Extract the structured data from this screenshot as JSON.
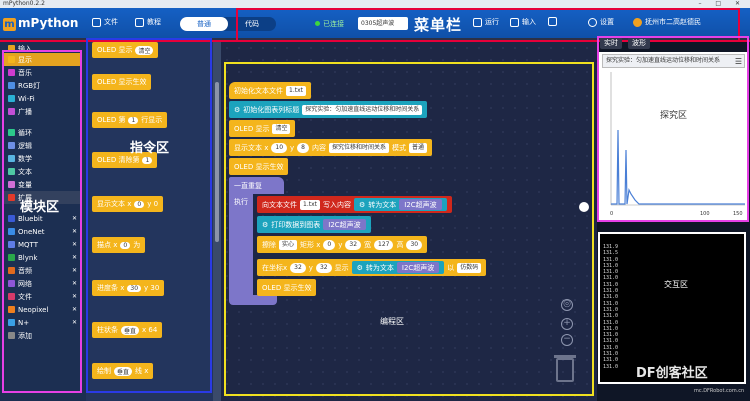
{
  "window": {
    "title": "mPython0.2.2"
  },
  "menubar": {
    "logo": "mPython",
    "file": "文件",
    "tutorial": "教程",
    "mode_normal": "普通",
    "mode_code": "代码",
    "connected": "已连接",
    "device": "0305超声波",
    "label": "菜单栏",
    "run": "运行",
    "import": "输入",
    "export": "",
    "settings": "设置",
    "user": "抚州市二高赵德民"
  },
  "categories": {
    "items": [
      {
        "label": "输入",
        "color": "#e4a320"
      },
      {
        "label": "显示",
        "color": "#f4b51c"
      },
      {
        "label": "音乐",
        "color": "#ce3ccf"
      },
      {
        "label": "RGB灯",
        "color": "#4f8ee3"
      },
      {
        "label": "Wi-Fi",
        "color": "#2ab0d4"
      },
      {
        "label": "广播",
        "color": "#c24fd6"
      },
      {
        "label": "循环",
        "color": "#2cc98a"
      },
      {
        "label": "逻辑",
        "color": "#6e8fe6"
      },
      {
        "label": "数学",
        "color": "#59b4e0"
      },
      {
        "label": "文本",
        "color": "#4fc8a3"
      },
      {
        "label": "变量",
        "color": "#d06fd6"
      },
      {
        "label": "扩展",
        "color": "#e23a2a"
      },
      {
        "label": "Bluebit",
        "color": "#3a5ad6"
      },
      {
        "label": "OneNet",
        "color": "#3a8ce6"
      },
      {
        "label": "MQTT",
        "color": "#5f7ce6"
      },
      {
        "label": "Blynk",
        "color": "#2aa84a"
      },
      {
        "label": "音频",
        "color": "#e06a1e"
      },
      {
        "label": "网络",
        "color": "#8f56d6"
      },
      {
        "label": "文件",
        "color": "#d63a6a"
      },
      {
        "label": "Neopixel",
        "color": "#f07f1e"
      },
      {
        "label": "N+",
        "color": "#3aa0e6"
      },
      {
        "label": "添加",
        "color": "#888888"
      }
    ],
    "area_label": "模块区"
  },
  "commands": {
    "area_label": "指令区",
    "items": [
      {
        "text": "OLED 显示",
        "field": "清空"
      },
      {
        "text": "OLED 显示生效",
        "field": ""
      },
      {
        "text": "OLED 第",
        "field": "1",
        "tail": "行显示"
      },
      {
        "text": "OLED 清除第",
        "field": "1",
        "tail": ""
      },
      {
        "text": "显示文本 x",
        "field": "0",
        "tail": "y 0"
      },
      {
        "text": "描点 x",
        "field": "0",
        "tail": "为"
      },
      {
        "text": "进度条 x",
        "field": "30",
        "tail": "y 30"
      },
      {
        "text": "柱状条",
        "field": "垂直",
        "tail": "x 64"
      },
      {
        "text": "绘制",
        "field": "垂直",
        "tail": "线 x"
      }
    ]
  },
  "editor": {
    "area_label": "编程区",
    "init_file": "初始化文本文件",
    "init_file_name": "1.txt",
    "init_chart": "初始化图表列标题",
    "init_chart_title": "探究实验：匀加速直线运动位移和时间关系",
    "oled_show": "OLED 显示",
    "oled_show_opt": "清空",
    "show_text_x": "显示文本 x",
    "show_text_x_val": "10",
    "show_text_y": "y",
    "show_text_y_val": "8",
    "show_text_content": "内容",
    "show_text_content_val": "探究位移和时间关系",
    "show_text_mode": "模式",
    "show_text_mode_val": "普通",
    "oled_effect": "OLED 显示生效",
    "loop": "一直重复",
    "exec": "执行",
    "write_file": "向文本文件",
    "write_file_name": "1.txt",
    "write_content": "写入内容",
    "to_text": "转为文本",
    "sensor": "I2C超声波",
    "print_chart": "打印数据到图表",
    "print_chart_sensor": "I2C超声波",
    "erase": "擦除",
    "erase_opt": "实心",
    "rect": "矩形 x",
    "rect_x": "0",
    "rect_y_label": "y",
    "rect_y": "32",
    "rect_w_label": "宽",
    "rect_w": "127",
    "rect_h_label": "高",
    "rect_h": "30",
    "at_x": "在坐标x",
    "at_x_val": "32",
    "at_y_label": "y",
    "at_y_val": "32",
    "display": "显示",
    "to_text2": "转为文本",
    "sensor2": "I2C超声波",
    "as": "以",
    "font": "仿数码",
    "oled_effect2": "OLED 显示生效"
  },
  "explore": {
    "tab1": "实时",
    "tab2": "波形",
    "chart_title": "探究实验：匀加速直线运动位移和时间关系",
    "label": "探究区",
    "x_ticks": [
      "0",
      "100",
      "150"
    ]
  },
  "interact": {
    "tab1": "",
    "tab2": "",
    "label": "交互区",
    "log": [
      "131.9",
      "131.5",
      "131.0",
      "131.0",
      "131.0",
      "131.0",
      "131.0",
      "131.0",
      "131.0",
      "131.0",
      "131.0",
      "131.0",
      "131.0",
      "131.0",
      "131.0",
      "131.0",
      "131.0",
      "131.0",
      "131.0",
      "131.0"
    ]
  },
  "watermark": {
    "brand": "DF创客社区",
    "url": "mc.DFRobot.com.cn"
  }
}
